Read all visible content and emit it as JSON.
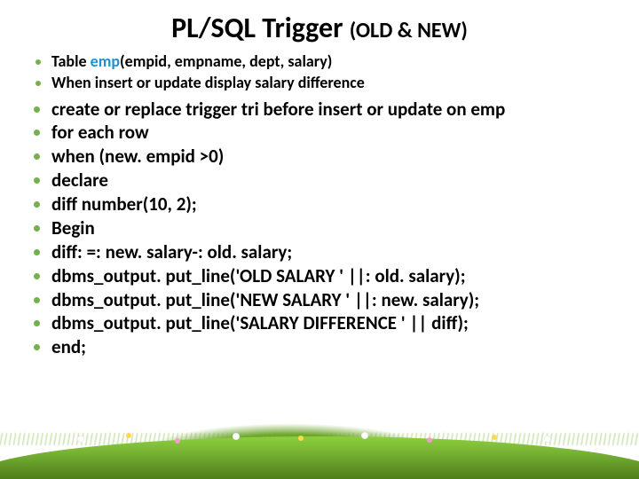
{
  "title": {
    "part1": "PL/SQL",
    "part2": "Trigger",
    "parens": "(OLD & NEW)"
  },
  "intro": [
    {
      "prefix": "Table   ",
      "emp_token": "emp",
      "rest": "(empid, empname, dept, salary)"
    },
    {
      "text": "When insert or update display salary difference"
    }
  ],
  "code": [
    "create or replace trigger tri before insert or update on emp",
    "for each row",
    "when (new. empid >0)",
    "declare",
    " diff number(10, 2);",
    "Begin",
    " diff: =: new. salary-: old. salary;",
    "  dbms_output. put_line('OLD SALARY ' ||: old. salary);",
    "  dbms_output. put_line('NEW SALARY ' ||: new. salary);",
    "  dbms_output. put_line('SALARY DIFFERENCE ' || diff);",
    "end;"
  ]
}
